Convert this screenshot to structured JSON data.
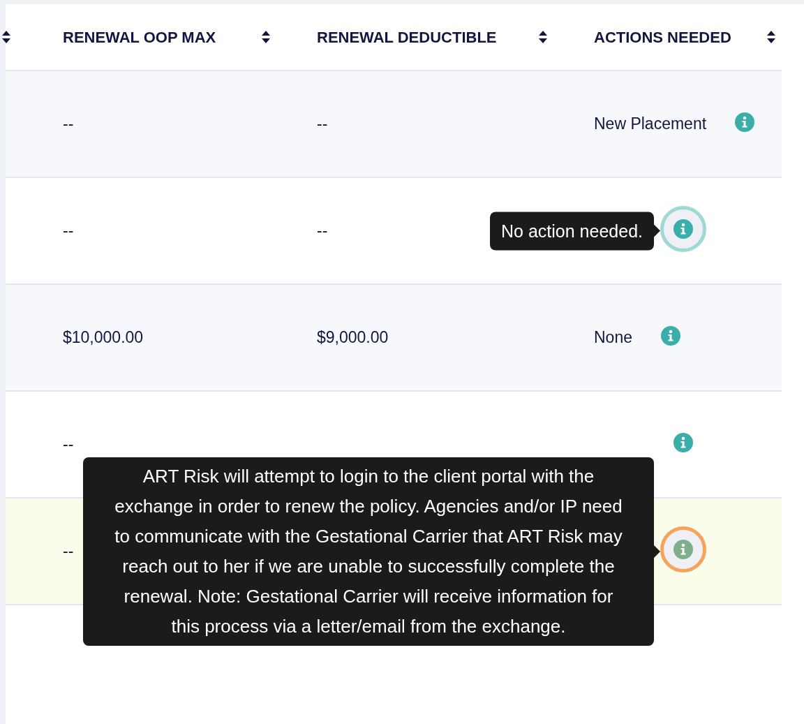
{
  "table": {
    "columns": [
      {
        "label": "RENEWAL OOP MAX"
      },
      {
        "label": "RENEWAL DEDUCTIBLE"
      },
      {
        "label": "ACTIONS NEEDED"
      }
    ],
    "rows": [
      {
        "highlighted": false,
        "oop_max": "--",
        "deductible": "--",
        "action": "New Placement"
      },
      {
        "highlighted": false,
        "oop_max": "--",
        "deductible": "--",
        "info_ring": {
          "color": "#9fd9d3"
        },
        "tooltip": "No action needed."
      },
      {
        "highlighted": false,
        "oop_max": "$10,000.00",
        "deductible": "$9,000.00",
        "action": "None"
      },
      {
        "highlighted": false,
        "oop_max": "--"
      },
      {
        "highlighted": true,
        "oop_max": "--",
        "info_ring": {
          "color": "#f6a35c"
        },
        "tooltip": "ART Risk will attempt to login to the client portal with the exchange in order to renew the policy. Agencies and/or IP need to communicate with the Gestational Carrier that ART Risk may reach out to her if we are unable to successfully complete the renewal. Note: Gestational Carrier will receive information for this process via a letter/email from the exchange."
      }
    ]
  }
}
